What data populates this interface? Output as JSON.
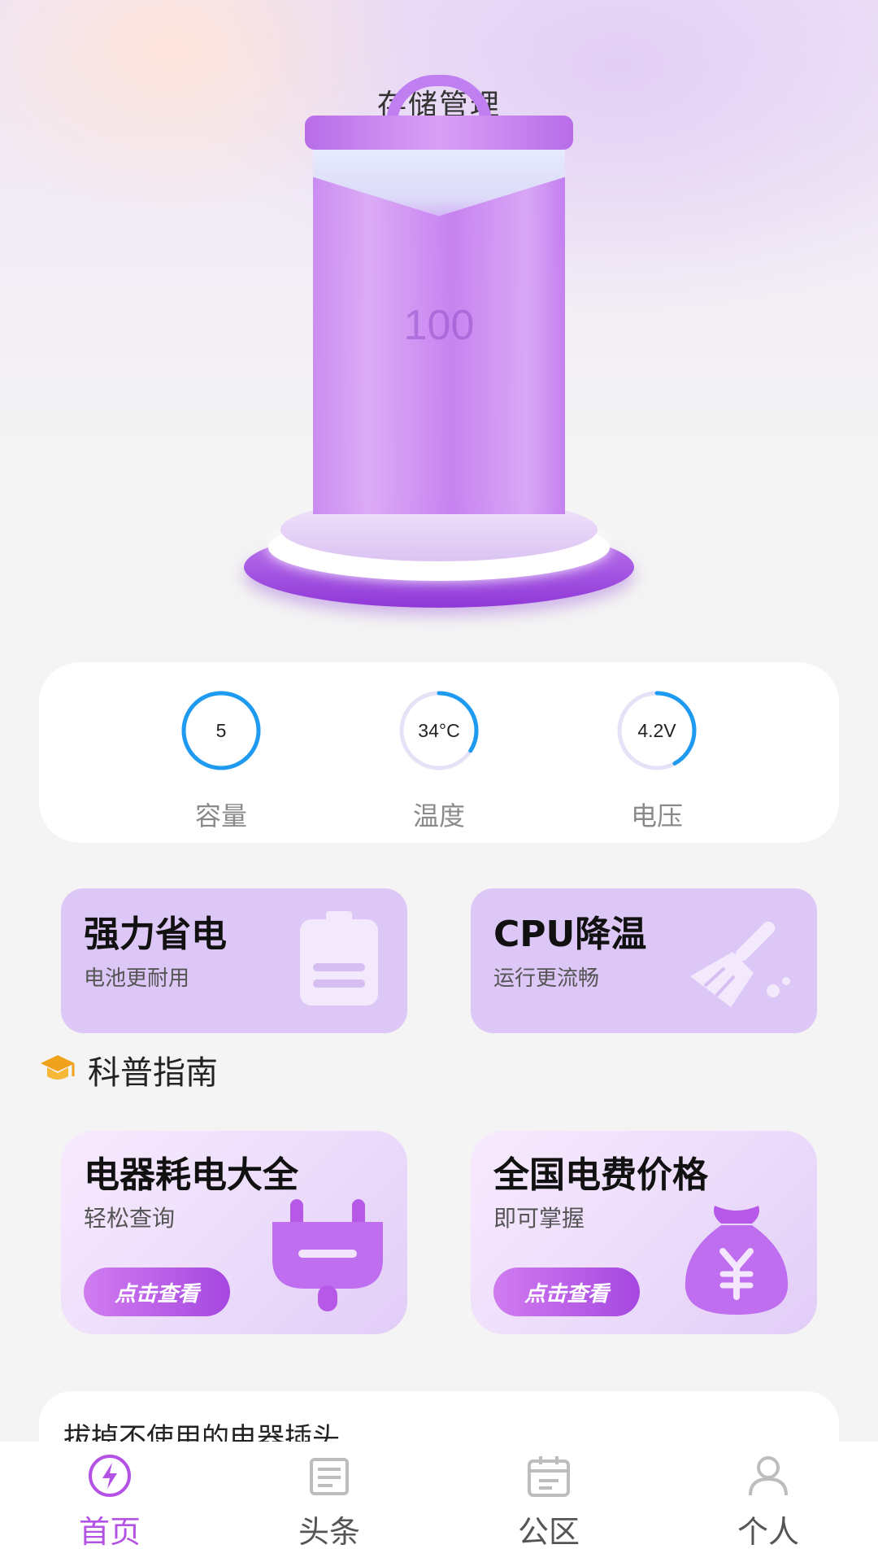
{
  "page": {
    "title": "存储管理"
  },
  "battery": {
    "level": "100"
  },
  "stats": [
    {
      "label": "容量",
      "value": "5",
      "progress": 1.0
    },
    {
      "label": "温度",
      "value": "34°C",
      "progress": 0.34
    },
    {
      "label": "电压",
      "value": "4.2V",
      "progress": 0.42
    }
  ],
  "features": [
    {
      "title": "强力省电",
      "subtitle": "电池更耐用",
      "icon": "battery-icon"
    },
    {
      "title": "CPU降温",
      "subtitle": "运行更流畅",
      "icon": "broom-icon"
    }
  ],
  "guide": {
    "heading": "科普指南",
    "heading_icon": "graduation-cap-icon",
    "cards": [
      {
        "title": "电器耗电大全",
        "subtitle": "轻松查询",
        "button": "点击查看",
        "icon": "plug-icon"
      },
      {
        "title": "全国电费价格",
        "subtitle": "即可掌握",
        "button": "点击查看",
        "icon": "money-bag-icon"
      }
    ]
  },
  "tip": {
    "text": "拔掉不使用的电器插头"
  },
  "nav": {
    "items": [
      {
        "label": "首页",
        "icon": "lightning-icon",
        "active": true
      },
      {
        "label": "头条",
        "icon": "news-icon",
        "active": false
      },
      {
        "label": "公区",
        "icon": "calendar-icon",
        "active": false
      },
      {
        "label": "个人",
        "icon": "person-icon",
        "active": false
      }
    ]
  },
  "colors": {
    "accent": "#b452e6",
    "ring": "#1e9af0",
    "ring_track": "#e4e2f6",
    "card_purple": "#dcc7f6"
  }
}
